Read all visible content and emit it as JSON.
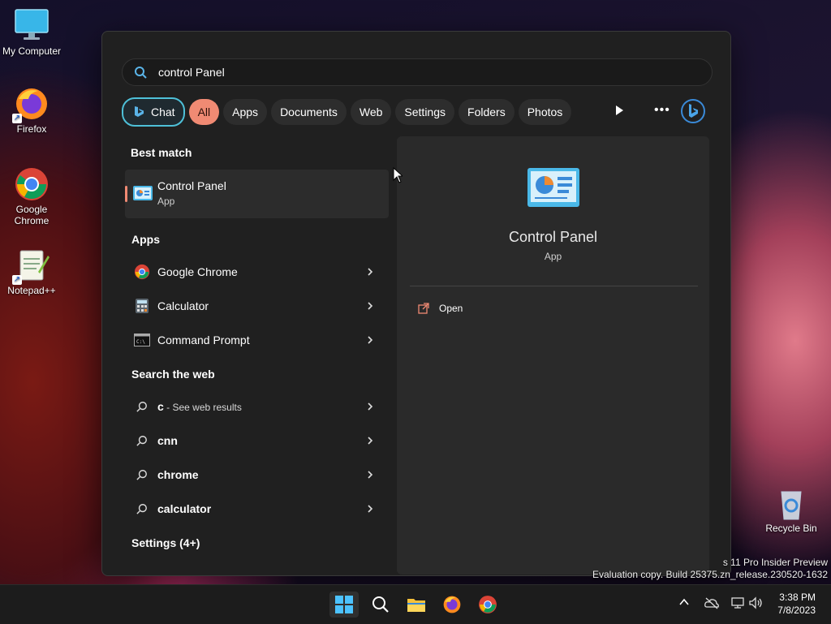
{
  "desktop": {
    "icons": [
      {
        "label": "My Computer"
      },
      {
        "label": "Firefox"
      },
      {
        "label": "Google Chrome"
      },
      {
        "label": "Notepad++"
      },
      {
        "label": "Recycle Bin"
      }
    ]
  },
  "search": {
    "query": "control Panel",
    "filters": [
      "Chat",
      "All",
      "Apps",
      "Documents",
      "Web",
      "Settings",
      "Folders",
      "Photos"
    ],
    "selected_filter": "All"
  },
  "best_match": {
    "heading": "Best match",
    "name": "Control Panel",
    "type": "App"
  },
  "apps": {
    "heading": "Apps",
    "items": [
      {
        "label": "Google Chrome",
        "icon": "chrome-icon"
      },
      {
        "label": "Calculator",
        "icon": "calculator-icon"
      },
      {
        "label": "Command Prompt",
        "icon": "command-prompt-icon"
      }
    ]
  },
  "web": {
    "heading": "Search the web",
    "first_query": "c",
    "first_suffix": " - See web results",
    "items": [
      {
        "label": "cnn"
      },
      {
        "label": "chrome"
      },
      {
        "label": "calculator"
      }
    ]
  },
  "settings_heading": "Settings (4+)",
  "preview": {
    "name": "Control Panel",
    "type": "App",
    "actions": [
      {
        "label": "Open",
        "icon": "open-external-icon"
      }
    ]
  },
  "watermark": {
    "line1": "s 11 Pro Insider Preview",
    "line2": "Evaluation copy. Build 25375.zn_release.230520-1632"
  },
  "taskbar": {
    "apps": [
      "start-icon",
      "search-icon",
      "file-explorer-icon",
      "firefox-icon",
      "chrome-icon"
    ],
    "time": "3:38 PM",
    "date": "7/8/2023"
  },
  "colors": {
    "accent": "#f08a73",
    "chat_border": "#4ec0d8",
    "panel_bg": "#202020"
  }
}
